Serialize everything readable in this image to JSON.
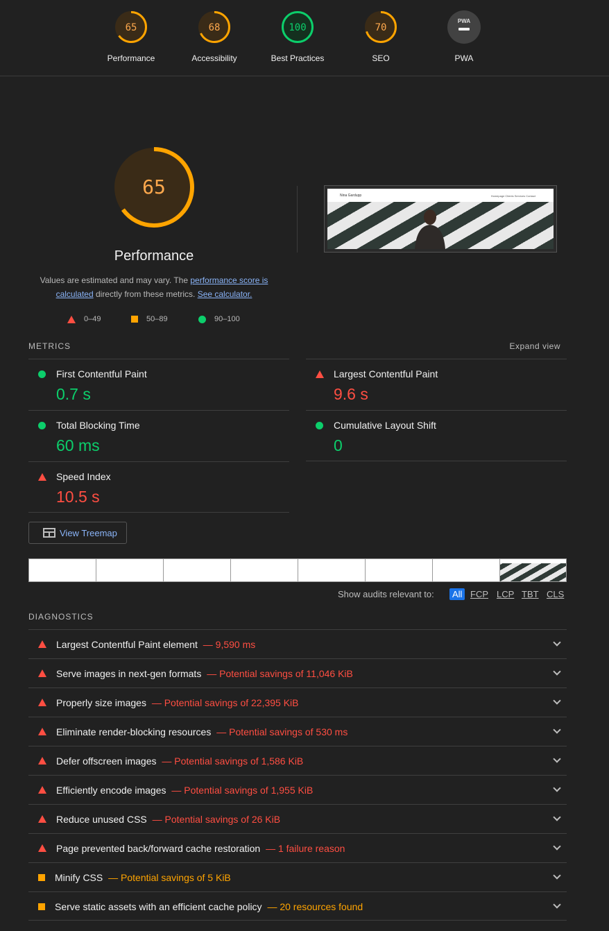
{
  "top_gauges": [
    {
      "label": "Performance",
      "score": "65",
      "value": 65,
      "color": "#ffa400"
    },
    {
      "label": "Accessibility",
      "score": "68",
      "value": 68,
      "color": "#ffa400"
    },
    {
      "label": "Best Practices",
      "score": "100",
      "value": 100,
      "color": "#0cce6b"
    },
    {
      "label": "SEO",
      "score": "70",
      "value": 70,
      "color": "#ffa400"
    },
    {
      "label": "PWA",
      "score": "PWA",
      "value": null,
      "color": "#9e9e9e"
    }
  ],
  "performance": {
    "score": "65",
    "value": 65,
    "title": "Performance",
    "desc_prefix": "Values are estimated and may vary. The ",
    "desc_link1": "performance score is calculated",
    "desc_middle": " directly from these metrics. ",
    "desc_link2": "See calculator."
  },
  "screenshot": {
    "brand": "Nina Gardupp",
    "nav": "Homepage   Clients   Services   Contact"
  },
  "legend": {
    "fail": "0–49",
    "average": "50–89",
    "pass": "90–100"
  },
  "metrics_section": {
    "title": "METRICS",
    "expand_label": "Expand view"
  },
  "metrics": [
    {
      "name": "First Contentful Paint",
      "value": "0.7 s",
      "status": "pass"
    },
    {
      "name": "Largest Contentful Paint",
      "value": "9.6 s",
      "status": "fail"
    },
    {
      "name": "Total Blocking Time",
      "value": "60 ms",
      "status": "pass"
    },
    {
      "name": "Cumulative Layout Shift",
      "value": "0",
      "status": "pass"
    },
    {
      "name": "Speed Index",
      "value": "10.5 s",
      "status": "fail"
    }
  ],
  "treemap_label": "View Treemap",
  "filter": {
    "label": "Show audits relevant to:",
    "options": [
      "All",
      "FCP",
      "LCP",
      "TBT",
      "CLS"
    ],
    "selected": "All"
  },
  "diagnostics_section": {
    "title": "DIAGNOSTICS"
  },
  "diagnostics": [
    {
      "title": "Largest Contentful Paint element",
      "detail": "— 9,590 ms",
      "status": "fail"
    },
    {
      "title": "Serve images in next-gen formats",
      "detail": "— Potential savings of 11,046 KiB",
      "status": "fail"
    },
    {
      "title": "Properly size images",
      "detail": "— Potential savings of 22,395 KiB",
      "status": "fail"
    },
    {
      "title": "Eliminate render-blocking resources",
      "detail": "— Potential savings of 530 ms",
      "status": "fail"
    },
    {
      "title": "Defer offscreen images",
      "detail": "— Potential savings of 1,586 KiB",
      "status": "fail"
    },
    {
      "title": "Efficiently encode images",
      "detail": "— Potential savings of 1,955 KiB",
      "status": "fail"
    },
    {
      "title": "Reduce unused CSS",
      "detail": "— Potential savings of 26 KiB",
      "status": "fail"
    },
    {
      "title": "Page prevented back/forward cache restoration",
      "detail": "— 1 failure reason",
      "status": "fail"
    },
    {
      "title": "Minify CSS",
      "detail": "— Potential savings of 5 KiB",
      "status": "average"
    },
    {
      "title": "Serve static assets with an efficient cache policy",
      "detail": "— 20 resources found",
      "status": "average"
    }
  ]
}
